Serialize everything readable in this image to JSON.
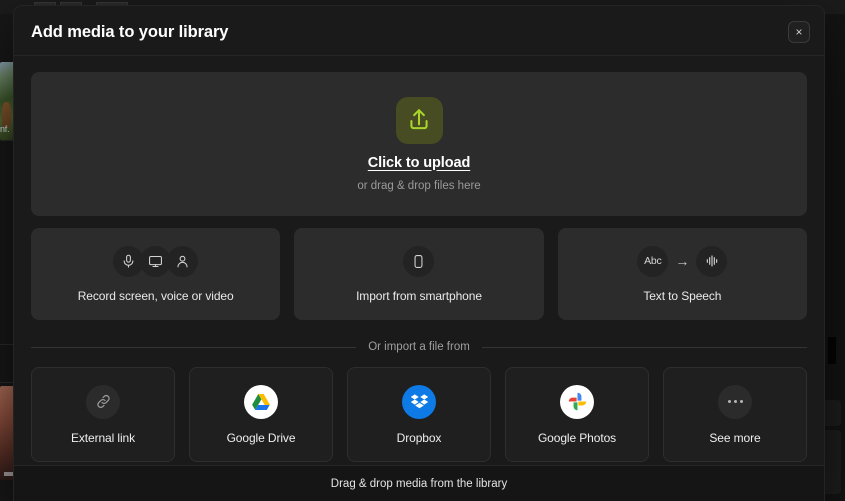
{
  "window": {
    "background_app_caption": "nf."
  },
  "modal": {
    "title": "Add media to your library",
    "close_label": "×",
    "dropzone": {
      "icon": "upload-arrow-icon",
      "title": "Click to upload",
      "subtitle": "or drag & drop files here"
    },
    "actions": [
      {
        "label": "Record screen, voice or video",
        "icons": [
          "microphone-icon",
          "monitor-icon",
          "person-icon"
        ]
      },
      {
        "label": "Import from smartphone",
        "icons": [
          "smartphone-icon"
        ]
      },
      {
        "label": "Text to Speech",
        "icons": [
          "abc-icon",
          "arrow-right-icon",
          "waveform-icon"
        ],
        "abc_text": "Abc",
        "arrow_glyph": "→"
      }
    ],
    "divider_label": "Or import a file from",
    "services": [
      {
        "label": "External link",
        "icon": "link-icon"
      },
      {
        "label": "Google Drive",
        "icon": "google-drive-icon"
      },
      {
        "label": "Dropbox",
        "icon": "dropbox-icon"
      },
      {
        "label": "Google Photos",
        "icon": "google-photos-icon"
      },
      {
        "label": "See more",
        "icon": "ellipsis-icon"
      }
    ],
    "footer_text": "Drag & drop media from the library"
  },
  "colors": {
    "modal_bg": "#1a1a1a",
    "dropzone_bg": "#2c2c2c",
    "accent_lime": "#a9d42a",
    "accent_tile": "#474c22",
    "dropbox_blue": "#0d7ae5"
  }
}
